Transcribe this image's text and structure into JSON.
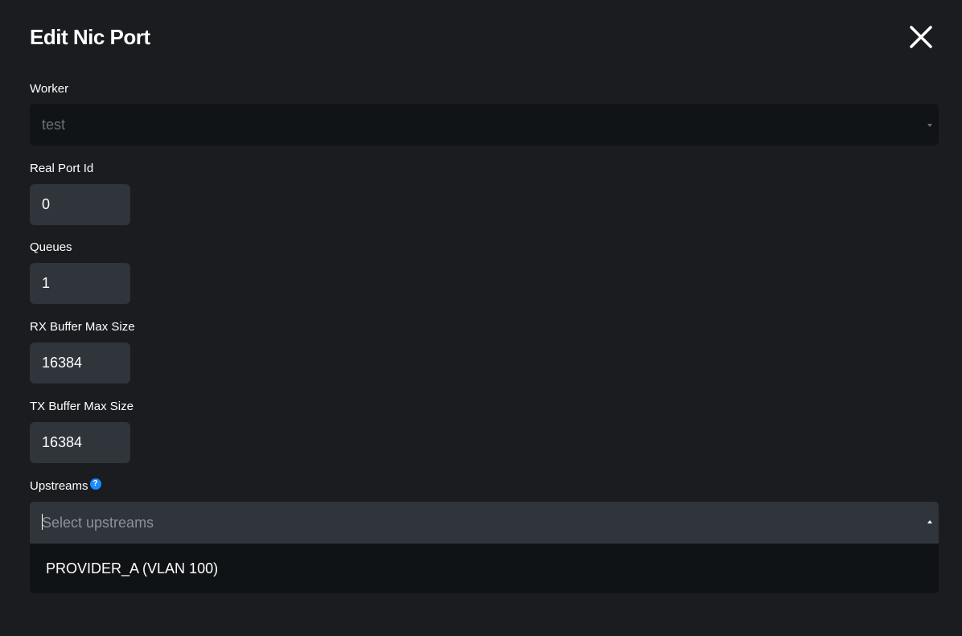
{
  "modal": {
    "title": "Edit Nic Port"
  },
  "fields": {
    "worker": {
      "label": "Worker",
      "value": "test"
    },
    "real_port_id": {
      "label": "Real Port Id",
      "value": "0"
    },
    "queues": {
      "label": "Queues",
      "value": "1"
    },
    "rx_buffer": {
      "label": "RX Buffer Max Size",
      "value": "16384"
    },
    "tx_buffer": {
      "label": "TX Buffer Max Size",
      "value": "16384"
    },
    "upstreams": {
      "label": "Upstreams",
      "help_icon": "question-circle-icon",
      "placeholder": "Select upstreams",
      "options": [
        "PROVIDER_A (VLAN 100)"
      ]
    }
  },
  "icons": {
    "close": "close-icon",
    "help": "question-circle-icon"
  },
  "colors": {
    "background": "#1b1c20",
    "input_background": "#30343b",
    "disabled_select_background": "#111416",
    "dropdown_background": "#101315",
    "help_accent": "#1a8cff",
    "text": "#ffffff",
    "muted_text": "#8d9298"
  }
}
